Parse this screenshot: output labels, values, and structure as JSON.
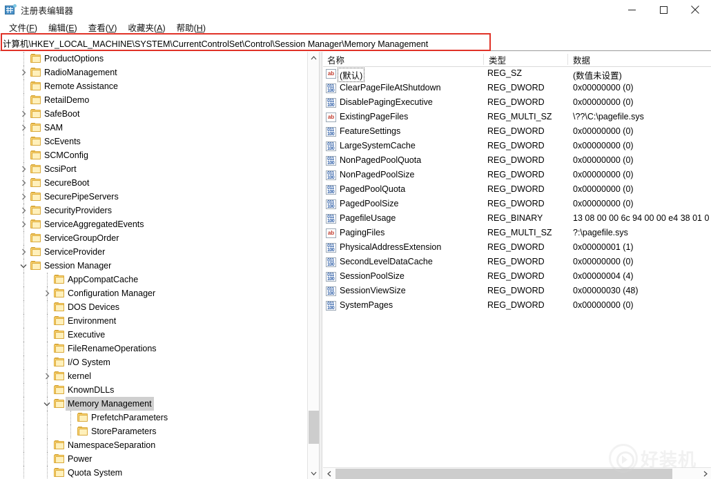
{
  "window": {
    "title": "注册表编辑器",
    "icon": "registry-editor-icon",
    "controls": {
      "minimize": "最小化",
      "maximize": "最大化",
      "close": "关闭"
    }
  },
  "menubar": {
    "items": [
      {
        "label": "文件(F)",
        "text": "文件",
        "accel": "F"
      },
      {
        "label": "编辑(E)",
        "text": "编辑",
        "accel": "E"
      },
      {
        "label": "查看(V)",
        "text": "查看",
        "accel": "V"
      },
      {
        "label": "收藏夹(A)",
        "text": "收藏夹",
        "accel": "A"
      },
      {
        "label": "帮助(H)",
        "text": "帮助",
        "accel": "H"
      }
    ]
  },
  "address": {
    "path": "计算机\\HKEY_LOCAL_MACHINE\\SYSTEM\\CurrentControlSet\\Control\\Session Manager\\Memory Management",
    "highlight_color": "#e03127"
  },
  "tree": {
    "selected": "Memory Management",
    "items": [
      {
        "label": "ProductOptions",
        "depth": 2,
        "expander": "none"
      },
      {
        "label": "RadioManagement",
        "depth": 2,
        "expander": "collapsed"
      },
      {
        "label": "Remote Assistance",
        "depth": 2,
        "expander": "none"
      },
      {
        "label": "RetailDemo",
        "depth": 2,
        "expander": "none"
      },
      {
        "label": "SafeBoot",
        "depth": 2,
        "expander": "collapsed"
      },
      {
        "label": "SAM",
        "depth": 2,
        "expander": "collapsed"
      },
      {
        "label": "ScEvents",
        "depth": 2,
        "expander": "none"
      },
      {
        "label": "SCMConfig",
        "depth": 2,
        "expander": "none"
      },
      {
        "label": "ScsiPort",
        "depth": 2,
        "expander": "collapsed"
      },
      {
        "label": "SecureBoot",
        "depth": 2,
        "expander": "collapsed"
      },
      {
        "label": "SecurePipeServers",
        "depth": 2,
        "expander": "collapsed"
      },
      {
        "label": "SecurityProviders",
        "depth": 2,
        "expander": "collapsed"
      },
      {
        "label": "ServiceAggregatedEvents",
        "depth": 2,
        "expander": "collapsed"
      },
      {
        "label": "ServiceGroupOrder",
        "depth": 2,
        "expander": "none"
      },
      {
        "label": "ServiceProvider",
        "depth": 2,
        "expander": "collapsed"
      },
      {
        "label": "Session Manager",
        "depth": 2,
        "expander": "expanded"
      },
      {
        "label": "AppCompatCache",
        "depth": 3,
        "expander": "none"
      },
      {
        "label": "Configuration Manager",
        "depth": 3,
        "expander": "collapsed"
      },
      {
        "label": "DOS Devices",
        "depth": 3,
        "expander": "none"
      },
      {
        "label": "Environment",
        "depth": 3,
        "expander": "none"
      },
      {
        "label": "Executive",
        "depth": 3,
        "expander": "none"
      },
      {
        "label": "FileRenameOperations",
        "depth": 3,
        "expander": "none"
      },
      {
        "label": "I/O System",
        "depth": 3,
        "expander": "none"
      },
      {
        "label": "kernel",
        "depth": 3,
        "expander": "collapsed"
      },
      {
        "label": "KnownDLLs",
        "depth": 3,
        "expander": "none"
      },
      {
        "label": "Memory Management",
        "depth": 3,
        "expander": "expanded",
        "selected": true
      },
      {
        "label": "PrefetchParameters",
        "depth": 4,
        "expander": "none"
      },
      {
        "label": "StoreParameters",
        "depth": 4,
        "expander": "none"
      },
      {
        "label": "NamespaceSeparation",
        "depth": 3,
        "expander": "none"
      },
      {
        "label": "Power",
        "depth": 3,
        "expander": "none"
      },
      {
        "label": "Quota System",
        "depth": 3,
        "expander": "none"
      }
    ]
  },
  "list": {
    "columns": [
      {
        "label": "名称",
        "key": "name"
      },
      {
        "label": "类型",
        "key": "type"
      },
      {
        "label": "数据",
        "key": "data"
      }
    ],
    "rows": [
      {
        "icon": "string-value-icon",
        "name": "(默认)",
        "type": "REG_SZ",
        "data": "(数值未设置)",
        "focused": true
      },
      {
        "icon": "dword-value-icon",
        "name": "ClearPageFileAtShutdown",
        "type": "REG_DWORD",
        "data": "0x00000000 (0)"
      },
      {
        "icon": "dword-value-icon",
        "name": "DisablePagingExecutive",
        "type": "REG_DWORD",
        "data": "0x00000000 (0)"
      },
      {
        "icon": "string-value-icon",
        "name": "ExistingPageFiles",
        "type": "REG_MULTI_SZ",
        "data": "\\??\\C:\\pagefile.sys"
      },
      {
        "icon": "dword-value-icon",
        "name": "FeatureSettings",
        "type": "REG_DWORD",
        "data": "0x00000000 (0)"
      },
      {
        "icon": "dword-value-icon",
        "name": "LargeSystemCache",
        "type": "REG_DWORD",
        "data": "0x00000000 (0)"
      },
      {
        "icon": "dword-value-icon",
        "name": "NonPagedPoolQuota",
        "type": "REG_DWORD",
        "data": "0x00000000 (0)"
      },
      {
        "icon": "dword-value-icon",
        "name": "NonPagedPoolSize",
        "type": "REG_DWORD",
        "data": "0x00000000 (0)"
      },
      {
        "icon": "dword-value-icon",
        "name": "PagedPoolQuota",
        "type": "REG_DWORD",
        "data": "0x00000000 (0)"
      },
      {
        "icon": "dword-value-icon",
        "name": "PagedPoolSize",
        "type": "REG_DWORD",
        "data": "0x00000000 (0)"
      },
      {
        "icon": "dword-value-icon",
        "name": "PagefileUsage",
        "type": "REG_BINARY",
        "data": "13 08 00 00 6c 94 00 00 e4 38 01 0"
      },
      {
        "icon": "string-value-icon",
        "name": "PagingFiles",
        "type": "REG_MULTI_SZ",
        "data": "?:\\pagefile.sys"
      },
      {
        "icon": "dword-value-icon",
        "name": "PhysicalAddressExtension",
        "type": "REG_DWORD",
        "data": "0x00000001 (1)"
      },
      {
        "icon": "dword-value-icon",
        "name": "SecondLevelDataCache",
        "type": "REG_DWORD",
        "data": "0x00000000 (0)"
      },
      {
        "icon": "dword-value-icon",
        "name": "SessionPoolSize",
        "type": "REG_DWORD",
        "data": "0x00000004 (4)"
      },
      {
        "icon": "dword-value-icon",
        "name": "SessionViewSize",
        "type": "REG_DWORD",
        "data": "0x00000030 (48)"
      },
      {
        "icon": "dword-value-icon",
        "name": "SystemPages",
        "type": "REG_DWORD",
        "data": "0x00000000 (0)"
      }
    ]
  },
  "watermark": {
    "text": "好装机"
  }
}
